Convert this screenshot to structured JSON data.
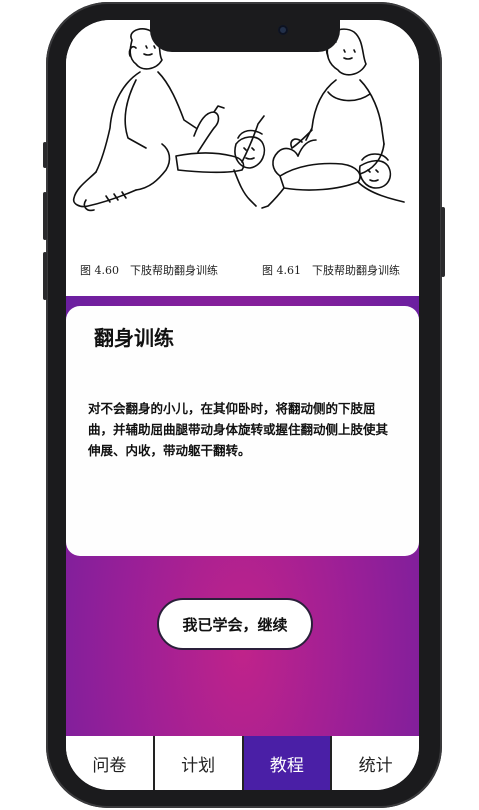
{
  "figure": {
    "caption_left": "图 4.60　下肢帮助翻身训练",
    "caption_right": "图 4.61　下肢帮助翻身训练"
  },
  "card": {
    "title": "翻身训练",
    "body": "对不会翻身的小儿，在其仰卧时，将翻动侧的下肢屈曲，并辅助屈曲腿带动身体旋转或握住翻动侧上肢使其伸展、内收，带动躯干翻转。"
  },
  "continue_button": "我已学会，继续",
  "tabs": [
    {
      "label": "问卷",
      "active": false
    },
    {
      "label": "计划",
      "active": false
    },
    {
      "label": "教程",
      "active": true
    },
    {
      "label": "统计",
      "active": false
    }
  ],
  "colors": {
    "active_tab": "#4a1fa6",
    "gradient_center": "#c0238a",
    "gradient_edge": "#6a1fa0"
  }
}
